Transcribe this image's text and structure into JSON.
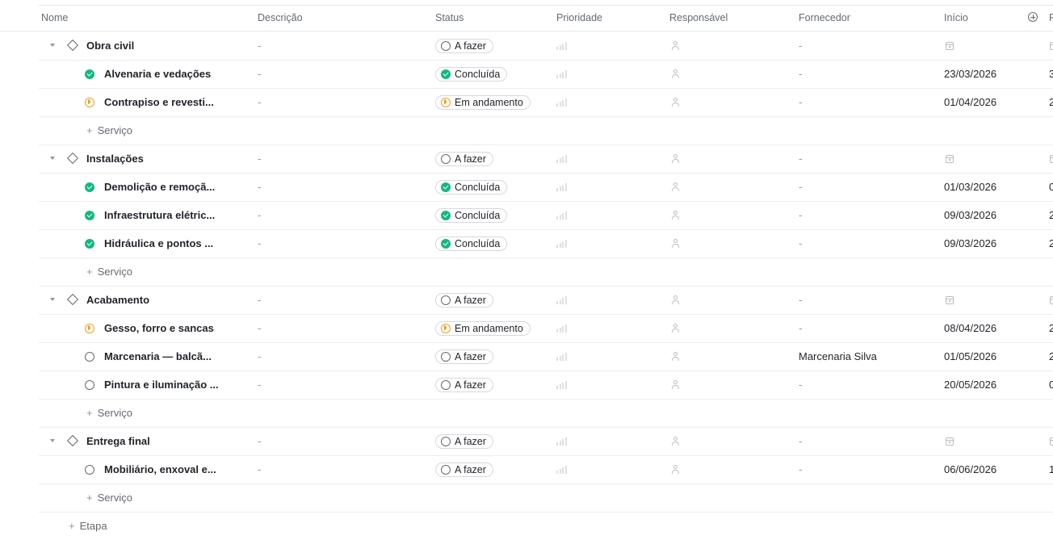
{
  "columns": {
    "name": "Nome",
    "description": "Descrição",
    "status": "Status",
    "priority": "Prioridade",
    "assignee": "Responsável",
    "supplier": "Fornecedor",
    "start": "Início",
    "next_partial": "F"
  },
  "add_service_label": "Serviço",
  "add_stage_label": "Etapa",
  "rows": [
    {
      "type": "stage",
      "name": "Obra civil",
      "description": "-",
      "status": "todo",
      "status_label": "A fazer",
      "supplier": "-",
      "start": "",
      "trail": ""
    },
    {
      "type": "task",
      "name": "Alvenaria e vedações",
      "description": "-",
      "status": "done",
      "status_label": "Concluída",
      "supplier": "-",
      "start": "23/03/2026",
      "trail": "3"
    },
    {
      "type": "task",
      "name": "Contrapiso e revesti...",
      "description": "-",
      "status": "progress",
      "status_label": "Em andamento",
      "supplier": "-",
      "start": "01/04/2026",
      "trail": "2"
    },
    {
      "type": "add",
      "label": "Serviço"
    },
    {
      "type": "stage",
      "name": "Instalações",
      "description": "-",
      "status": "todo",
      "status_label": "A fazer",
      "supplier": "-",
      "start": "",
      "trail": ""
    },
    {
      "type": "task",
      "name": "Demolição e remoçã...",
      "description": "-",
      "status": "done",
      "status_label": "Concluída",
      "supplier": "-",
      "start": "01/03/2026",
      "trail": "0"
    },
    {
      "type": "task",
      "name": "Infraestrutura elétric...",
      "description": "-",
      "status": "done",
      "status_label": "Concluída",
      "supplier": "-",
      "start": "09/03/2026",
      "trail": "2"
    },
    {
      "type": "task",
      "name": "Hidráulica e pontos ...",
      "description": "-",
      "status": "done",
      "status_label": "Concluída",
      "supplier": "-",
      "start": "09/03/2026",
      "trail": "2"
    },
    {
      "type": "add",
      "label": "Serviço"
    },
    {
      "type": "stage",
      "name": "Acabamento",
      "description": "-",
      "status": "todo",
      "status_label": "A fazer",
      "supplier": "-",
      "start": "",
      "trail": ""
    },
    {
      "type": "task",
      "name": "Gesso, forro e sancas",
      "description": "-",
      "status": "progress",
      "status_label": "Em andamento",
      "supplier": "-",
      "start": "08/04/2026",
      "trail": "2"
    },
    {
      "type": "task",
      "name": "Marcenaria — balcã...",
      "description": "-",
      "status": "todo",
      "status_label": "A fazer",
      "supplier": "Marcenaria Silva",
      "start": "01/05/2026",
      "trail": "2"
    },
    {
      "type": "task",
      "name": "Pintura e iluminação ...",
      "description": "-",
      "status": "todo",
      "status_label": "A fazer",
      "supplier": "-",
      "start": "20/05/2026",
      "trail": "0"
    },
    {
      "type": "add",
      "label": "Serviço"
    },
    {
      "type": "stage",
      "name": "Entrega final",
      "description": "-",
      "status": "todo",
      "status_label": "A fazer",
      "supplier": "-",
      "start": "",
      "trail": ""
    },
    {
      "type": "task",
      "name": "Mobiliário, enxoval e...",
      "description": "-",
      "status": "todo",
      "status_label": "A fazer",
      "supplier": "-",
      "start": "06/06/2026",
      "trail": "1"
    },
    {
      "type": "add",
      "label": "Serviço"
    }
  ],
  "colors": {
    "done": "#14b87f",
    "in_progress": "#f0a020",
    "border": "#e6e8eb",
    "muted_text": "#646a73"
  }
}
